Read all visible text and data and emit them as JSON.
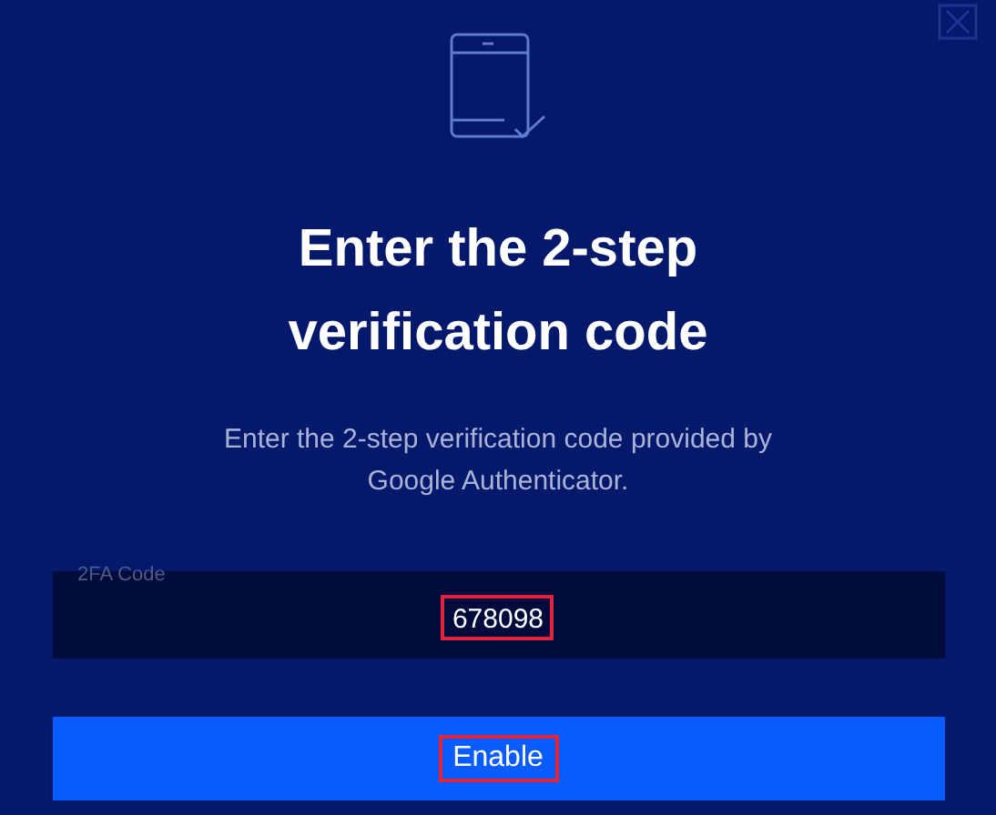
{
  "title_lines": [
    "Enter the 2-step",
    "verification code"
  ],
  "description": "Enter the 2-step verification code provided by Google Authenticator.",
  "code_field": {
    "label": "2FA Code",
    "value": "678098",
    "highlighted": true
  },
  "button": {
    "label": "Enable",
    "highlighted": true
  }
}
